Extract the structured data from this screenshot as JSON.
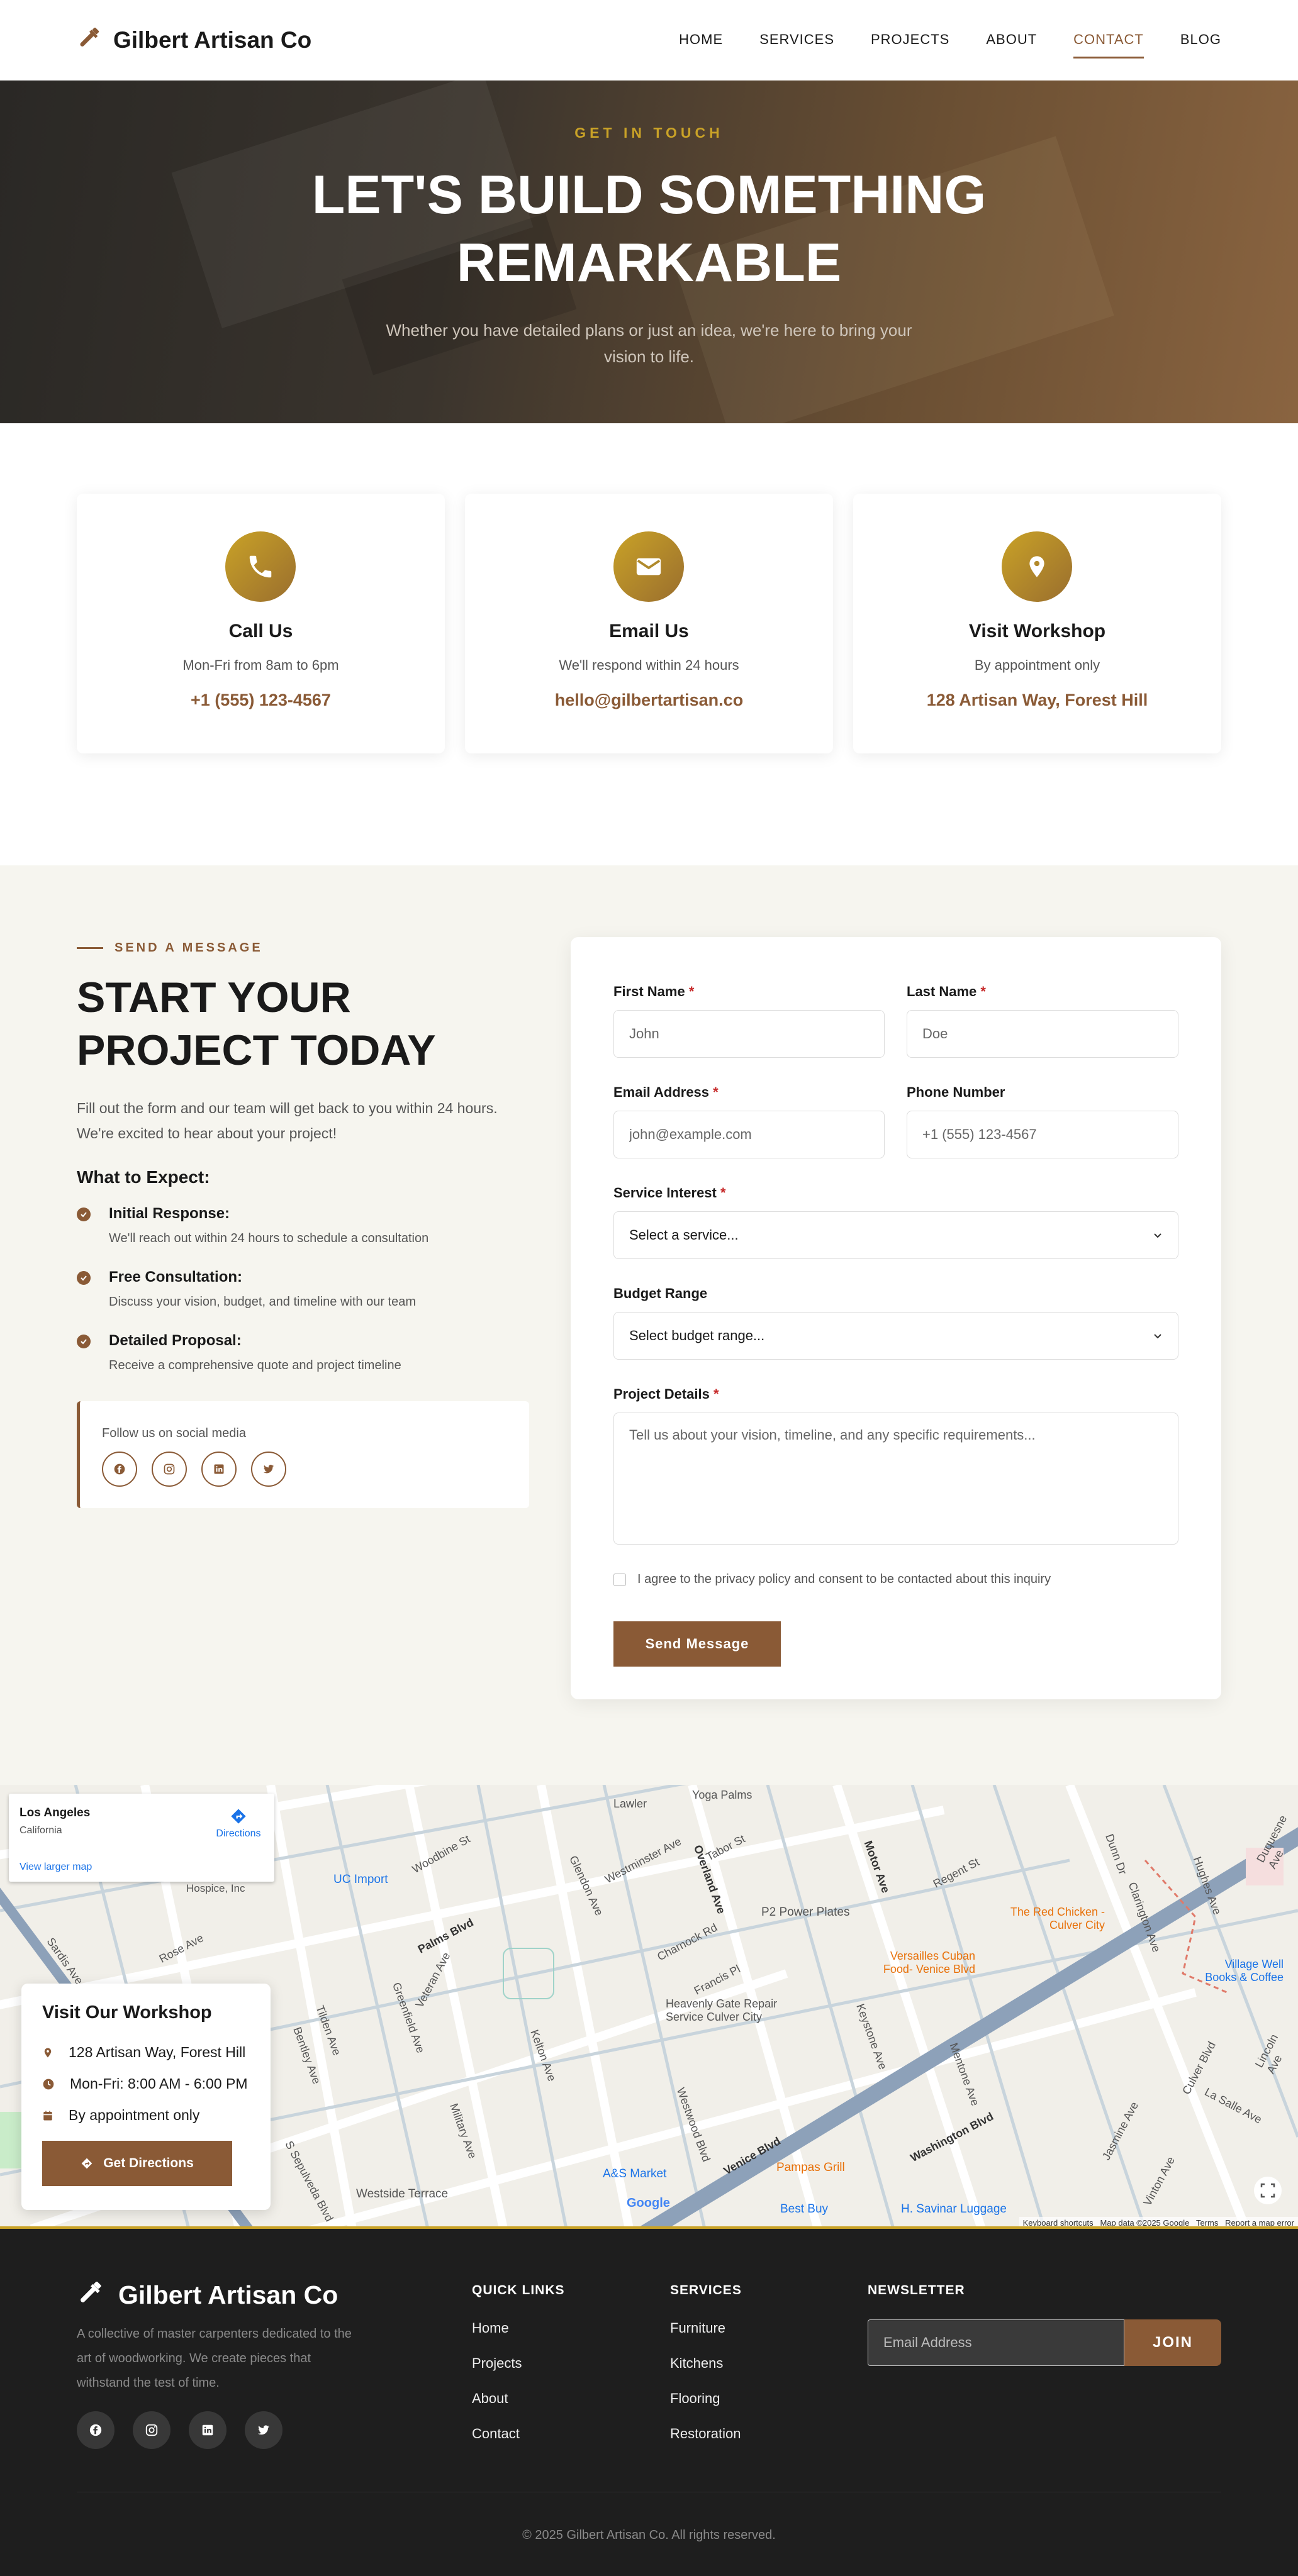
{
  "nav": {
    "brand": "Gilbert Artisan Co",
    "links": [
      "HOME",
      "SERVICES",
      "PROJECTS",
      "ABOUT",
      "CONTACT",
      "BLOG"
    ],
    "active": "CONTACT"
  },
  "hero": {
    "eyebrow": "GET IN TOUCH",
    "title_line1": "LET'S BUILD SOMETHING",
    "title_line2": "REMARKABLE",
    "subtitle": "Whether you have detailed plans or just an idea, we're here to bring your vision to life."
  },
  "cards": [
    {
      "icon": "phone-icon",
      "title": "Call Us",
      "desc": "Mon-Fri from 8am to 6pm",
      "value": "+1 (555) 123-4567"
    },
    {
      "icon": "envelope-icon",
      "title": "Email Us",
      "desc": "We'll respond within 24 hours",
      "value": "hello@gilbertartisan.co"
    },
    {
      "icon": "map-pin-icon",
      "title": "Visit Workshop",
      "desc": "By appointment only",
      "value": "128 Artisan Way, Forest Hill"
    }
  ],
  "intro": {
    "eyebrow": "SEND A MESSAGE",
    "title_line1": "START YOUR",
    "title_line2": "PROJECT TODAY",
    "desc": "Fill out the form and our team will get back to you within 24 hours. We're excited to hear about your project!",
    "expect_title": "What to Expect:",
    "expect": [
      {
        "title": "Initial Response:",
        "desc": "We'll reach out within 24 hours to schedule a consultation"
      },
      {
        "title": "Free Consultation:",
        "desc": "Discuss your vision, budget, and timeline with our team"
      },
      {
        "title": "Detailed Proposal:",
        "desc": "Receive a comprehensive quote and project timeline"
      }
    ],
    "social_label": "Follow us on social media"
  },
  "form": {
    "first_name": {
      "label": "First Name",
      "placeholder": "John"
    },
    "last_name": {
      "label": "Last Name",
      "placeholder": "Doe"
    },
    "email": {
      "label": "Email Address",
      "placeholder": "john@example.com"
    },
    "phone": {
      "label": "Phone Number",
      "placeholder": "+1 (555) 123-4567"
    },
    "service": {
      "label": "Service Interest",
      "value": "Select a service..."
    },
    "budget": {
      "label": "Budget Range",
      "value": "Select budget range..."
    },
    "details": {
      "label": "Project Details",
      "placeholder": "Tell us about your vision, timeline, and any specific requirements..."
    },
    "required_mark": "*",
    "consent": "I agree to the privacy policy and consent to be contacted about this inquiry",
    "submit": "Send Message"
  },
  "map": {
    "place_title": "Los Angeles",
    "place_sub": "California",
    "directions": "Directions",
    "larger_map": "View larger map",
    "streets": [
      "Woodbine St",
      "Lawler",
      "Yoga Palms",
      "Westminster Ave",
      "Glendon Ave",
      "Overland Ave",
      "Tabor St",
      "Motor Ave",
      "Regent St",
      "Palms Blvd",
      "Charnock Rd",
      "Francis Pl",
      "Veteran Ave",
      "Military Ave",
      "Kelton Ave",
      "Greenfield Ave",
      "Tilden Ave",
      "Venice Blvd",
      "Washington Blvd",
      "Culver Blvd",
      "Jasmine Ave",
      "La Salle Ave",
      "Westwood Blvd",
      "Keystone Ave",
      "Mentone Ave",
      "Rose Ave",
      "Sardis Ave",
      "S Sepulveda Blvd",
      "Bentley Ave",
      "Hughes Ave",
      "Duquesne Ave",
      "Dunn Dr",
      "Clarington Ave",
      "Lincoln Ave",
      "Vinton Ave"
    ],
    "pois": {
      "ucla": "UC Import",
      "westlake": "Westlake Village Hospice, Inc",
      "p2": "P2 Power Plates",
      "redchicken": "The Red Chicken - Culver City",
      "versailles": "Versailles Cuban Food- Venice Blvd",
      "villagewell": "Village Well Books & Coffee",
      "heavenly": "Heavenly Gate Repair Service Culver City",
      "westside": "Westside Terrace",
      "asmarket": "A&S Market",
      "pampas": "Pampas Grill",
      "bestbuy": "Best Buy",
      "savinar": "H. Savinar Luggage"
    },
    "attribution": [
      "Keyboard shortcuts",
      "Map data ©2025 Google",
      "Terms",
      "Report a map error"
    ],
    "google": "Google",
    "visit": {
      "title": "Visit Our Workshop",
      "address": "128 Artisan Way, Forest Hill",
      "hours": "Mon-Fri: 8:00 AM - 6:00 PM",
      "appointment": "By appointment only",
      "button": "Get Directions"
    }
  },
  "footer": {
    "brand": "Gilbert Artisan Co",
    "desc": "A collective of master carpenters dedicated to the art of woodworking. We create pieces that withstand the test of time.",
    "quick_title": "QUICK LINKS",
    "quick": [
      "Home",
      "Projects",
      "About",
      "Contact"
    ],
    "services_title": "SERVICES",
    "services": [
      "Furniture",
      "Kitchens",
      "Flooring",
      "Restoration"
    ],
    "newsletter_title": "NEWSLETTER",
    "email_placeholder": "Email Address",
    "join": "JOIN",
    "copyright": "© 2025 Gilbert Artisan Co. All rights reserved."
  },
  "colors": {
    "accent": "#8a5a36",
    "gold": "#c9a227",
    "footer_bg": "#1e1e1e",
    "section_bg": "#f6f5ef"
  }
}
